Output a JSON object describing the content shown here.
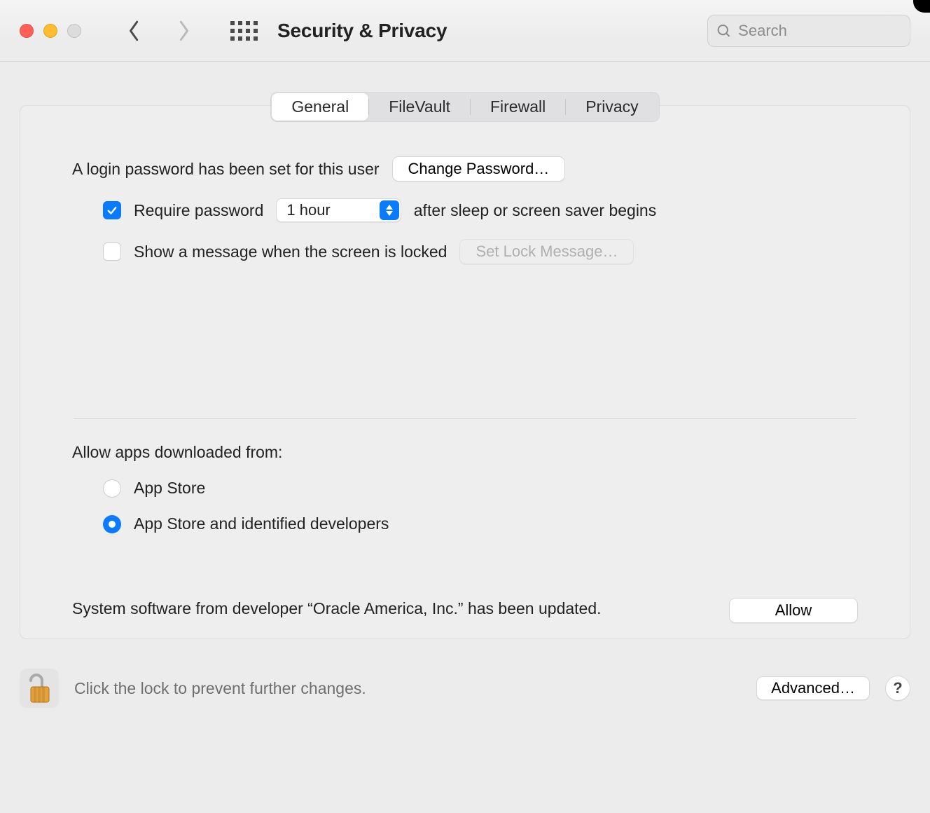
{
  "window": {
    "title": "Security & Privacy"
  },
  "search": {
    "placeholder": "Search",
    "value": ""
  },
  "tabs": {
    "items": [
      "General",
      "FileVault",
      "Firewall",
      "Privacy"
    ],
    "active_index": 0
  },
  "login": {
    "summary": "A login password has been set for this user",
    "change_button": "Change Password…",
    "require_password_label": "Require password",
    "require_password_checked": true,
    "delay_value": "1 hour",
    "after_sleep_suffix": "after sleep or screen saver begins",
    "show_lock_message_label": "Show a message when the screen is locked",
    "show_lock_message_checked": false,
    "set_lock_message_button": "Set Lock Message…",
    "set_lock_message_enabled": false
  },
  "gatekeeper": {
    "heading": "Allow apps downloaded from:",
    "options": [
      {
        "label": "App Store",
        "selected": false
      },
      {
        "label": "App Store and identified developers",
        "selected": true
      }
    ],
    "software_message": "System software from developer “Oracle America, Inc.” has been updated.",
    "allow_button": "Allow"
  },
  "footer": {
    "lock_message": "Click the lock to prevent further changes.",
    "advanced_button": "Advanced…",
    "help_label": "?"
  }
}
